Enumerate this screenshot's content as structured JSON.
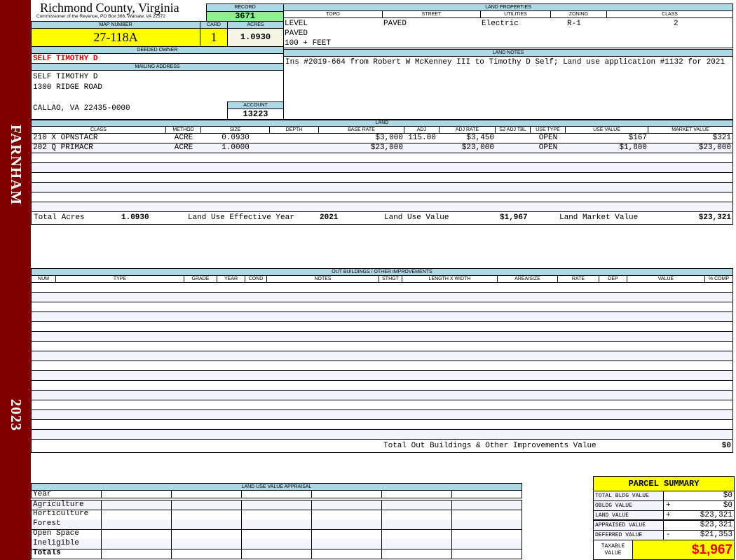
{
  "sidebar": {
    "district": "FARNHAM",
    "year": "2023",
    "color": "#7f0000"
  },
  "header": {
    "county": "Richmond County, Virginia",
    "office": "Commissioner of the Revenue, PO Box 366, Warsaw, VA 22572",
    "record_label": "RECORD",
    "record": "3671",
    "map_label": "MAP NUMBER",
    "map_number": "27-118A",
    "card_label": "CARD",
    "card": "1",
    "acres_label": "ACRES",
    "acres": "1.0930"
  },
  "owner": {
    "label": "DEEDED OWNER",
    "name": "SELF TIMOTHY D",
    "mailing_label": "MAILING ADDRESS",
    "address": [
      "SELF TIMOTHY D",
      "1300 RIDGE ROAD",
      "",
      "CALLAO, VA 22435-0000"
    ],
    "account_label": "ACCOUNT",
    "account": "13223"
  },
  "land_properties": {
    "label": "LAND PROPERTIES",
    "headers": [
      "TOPO",
      "STREET",
      "UTILITIES",
      "ZONING",
      "CLASS"
    ],
    "topo": [
      "LEVEL",
      "PAVED",
      "100 + FEET"
    ],
    "street": "PAVED",
    "utilities": "Electric",
    "zoning": "R-1",
    "class": "2"
  },
  "land_notes": {
    "label": "LAND NOTES",
    "text": "Ins #2019-664 from Robert W McKenney III to Timothy D Self; Land use application #1132 for 2021"
  },
  "land": {
    "label": "LAND",
    "headers": [
      "CLASS",
      "METHOD",
      "SIZE",
      "DEPTH",
      "BASE RATE",
      "ADJ",
      "ADJ RATE",
      "SZ ADJ TBL",
      "USE TYPE",
      "USE VALUE",
      "MARKET VALUE"
    ],
    "rows": [
      [
        "210 X OPNSTACR",
        "ACRE",
        "0.0930",
        "",
        "$3,000",
        "115.00",
        "$3,450",
        "",
        "OPEN",
        "$167",
        "$321"
      ],
      [
        "202 Q PRIMACR",
        "ACRE",
        "1.0000",
        "",
        "$23,000",
        "",
        "$23,000",
        "",
        "OPEN",
        "$1,800",
        "$23,000"
      ]
    ],
    "totals": {
      "acres_label": "Total Acres",
      "acres": "1.0930",
      "year_label": "Land Use Effective Year",
      "year": "2021",
      "use_label": "Land Use Value",
      "use_value": "$1,967",
      "market_label": "Land Market Value",
      "market_value": "$23,321"
    }
  },
  "outbuildings": {
    "label": "OUT BUILDINGS / OTHER IMPROVEMENTS",
    "headers": [
      "NUM",
      "TYPE",
      "GRADE",
      "YEAR",
      "COND",
      "NOTES",
      "STHGT",
      "LENGTH X WIDTH",
      "AREA/SIZE",
      "RATE",
      "DEP",
      "VALUE",
      "% COMP"
    ],
    "total_label": "Total Out Buildings & Other Improvements Value",
    "total": "$0"
  },
  "land_use": {
    "label": "LAND USE VALUE APPRAISAL",
    "rows": [
      "Year",
      "Agriculture",
      "Horticulture",
      "Forest",
      "Open Space",
      "Ineligible",
      "Totals"
    ]
  },
  "summary": {
    "title": "PARCEL SUMMARY",
    "rows": [
      {
        "label": "TOTAL BLDG VALUE",
        "op": "",
        "value": "$0"
      },
      {
        "label": "OBLDG VALUE",
        "op": "+",
        "value": "$0"
      },
      {
        "label": "LAND VALUE",
        "op": "+",
        "value": "$23,321"
      },
      {
        "label": "APPRAISED VALUE",
        "op": "",
        "value": "$23,321"
      },
      {
        "label": "DEFERRED VALUE",
        "op": "-",
        "value": "$21,353"
      }
    ],
    "taxable_label": "TAXABLE VALUE",
    "taxable": "$1,967"
  }
}
